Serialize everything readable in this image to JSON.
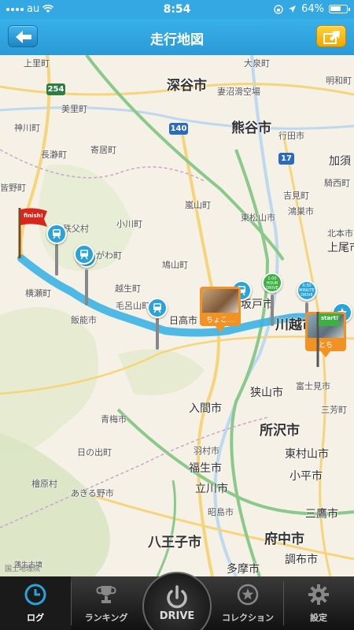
{
  "status": {
    "carrier": "au",
    "time": "8:54",
    "battery": "64%"
  },
  "nav": {
    "title": "走行地図"
  },
  "map": {
    "places": [
      {
        "name": "上里町",
        "size": ""
      },
      {
        "name": "美里町",
        "size": ""
      },
      {
        "name": "神川町",
        "size": ""
      },
      {
        "name": "長瀞町",
        "size": ""
      },
      {
        "name": "寄居町",
        "size": ""
      },
      {
        "name": "皆野町",
        "size": ""
      },
      {
        "name": "秩父村",
        "size": ""
      },
      {
        "name": "小川町",
        "size": ""
      },
      {
        "name": "ときがわ町",
        "size": ""
      },
      {
        "name": "嵐山町",
        "size": ""
      },
      {
        "name": "東松山市",
        "size": ""
      },
      {
        "name": "鳩山町",
        "size": ""
      },
      {
        "name": "越生町",
        "size": ""
      },
      {
        "name": "毛呂山町",
        "size": ""
      },
      {
        "name": "横瀬町",
        "size": ""
      },
      {
        "name": "飯能市",
        "size": ""
      },
      {
        "name": "日高市",
        "size": ""
      },
      {
        "name": "坂戸市",
        "size": "mid"
      },
      {
        "name": "川越市",
        "size": "big"
      },
      {
        "name": "狭山市",
        "size": "mid"
      },
      {
        "name": "入間市",
        "size": "mid"
      },
      {
        "name": "所沢市",
        "size": "big"
      },
      {
        "name": "富士見市",
        "size": ""
      },
      {
        "name": "三芳町",
        "size": ""
      },
      {
        "name": "青梅市",
        "size": ""
      },
      {
        "name": "日の出町",
        "size": ""
      },
      {
        "name": "羽村市",
        "size": ""
      },
      {
        "name": "福生市",
        "size": "mid"
      },
      {
        "name": "立川市",
        "size": "mid"
      },
      {
        "name": "東村山市",
        "size": "mid"
      },
      {
        "name": "小平市",
        "size": "mid"
      },
      {
        "name": "昭島市",
        "size": ""
      },
      {
        "name": "あきる野市",
        "size": ""
      },
      {
        "name": "檜原村",
        "size": ""
      },
      {
        "name": "八王子市",
        "size": "big"
      },
      {
        "name": "府中市",
        "size": "big"
      },
      {
        "name": "三鷹市",
        "size": "mid"
      },
      {
        "name": "調布市",
        "size": "mid"
      },
      {
        "name": "多摩市",
        "size": "mid"
      },
      {
        "name": "深谷市",
        "size": "big"
      },
      {
        "name": "熊谷市",
        "size": "big"
      },
      {
        "name": "行田市",
        "size": ""
      },
      {
        "name": "鴻巣市",
        "size": ""
      },
      {
        "name": "加須",
        "size": "mid"
      },
      {
        "name": "騎西町",
        "size": ""
      },
      {
        "name": "北本市",
        "size": ""
      },
      {
        "name": "上尾市",
        "size": "mid"
      },
      {
        "name": "吉見町",
        "size": ""
      },
      {
        "name": "大泉町",
        "size": ""
      },
      {
        "name": "明和町",
        "size": ""
      },
      {
        "name": "妻沼滑空場",
        "size": ""
      },
      {
        "name": "蓮生古墳",
        "size": ""
      }
    ],
    "routes": [
      "254",
      "140",
      "17"
    ],
    "markers": {
      "finish_label": "finish!",
      "start_label": "start!",
      "photo1_caption": "ちょこ…",
      "photo2_caption": "とち",
      "green_pin_1": "1:00\nHOUR\nDRIVE",
      "green_pin_2": "0:30\nMINUTE\nDRIVE"
    },
    "attribution": "国土地理院"
  },
  "tabs": [
    {
      "label": "ログ",
      "icon": "clock-icon",
      "active": true
    },
    {
      "label": "ランキング",
      "icon": "trophy-icon",
      "active": false
    },
    {
      "label": "DRIVE",
      "icon": "power-icon",
      "active": false
    },
    {
      "label": "コレクション",
      "icon": "star-icon",
      "active": false
    },
    {
      "label": "設定",
      "icon": "gear-icon",
      "active": false
    }
  ],
  "colors": {
    "accent": "#2a9ad6",
    "route": "#3bb3e3",
    "share": "#f0a800",
    "pin": "#2aa3d8",
    "photo": "#f39224"
  }
}
